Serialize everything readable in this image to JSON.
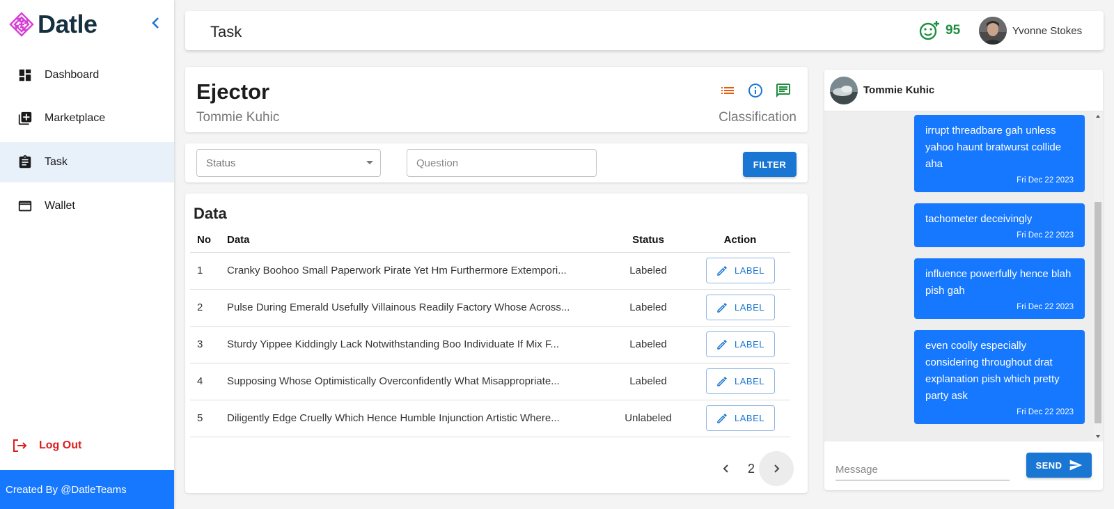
{
  "app": {
    "name": "Datle"
  },
  "sidebar": {
    "items": [
      {
        "label": "Dashboard",
        "icon": "dashboard-icon"
      },
      {
        "label": "Marketplace",
        "icon": "add-box-icon"
      },
      {
        "label": "Task",
        "icon": "clipboard-icon"
      },
      {
        "label": "Wallet",
        "icon": "wallet-icon"
      }
    ],
    "active": "Task",
    "logout": "Log Out",
    "footer": "Created By @DatleTeams"
  },
  "header": {
    "title": "Task",
    "score": "95",
    "user_name": "Yvonne Stokes"
  },
  "task": {
    "title": "Ejector",
    "owner": "Tommie Kuhic",
    "type": "Classification"
  },
  "filters": {
    "status_placeholder": "Status",
    "question_placeholder": "Question",
    "filter_label": "FILTER"
  },
  "data_table": {
    "title": "Data",
    "headers": {
      "no": "No",
      "data": "Data",
      "status": "Status",
      "action": "Action"
    },
    "action_label": "LABEL",
    "rows": [
      {
        "no": "1",
        "data": "Cranky Boohoo Small Paperwork Pirate Yet Hm Furthermore Extempori...",
        "status": "Labeled"
      },
      {
        "no": "2",
        "data": "Pulse During Emerald Usefully Villainous Readily Factory Whose Across...",
        "status": "Labeled"
      },
      {
        "no": "3",
        "data": "Sturdy Yippee Kiddingly Lack Notwithstanding Boo Individuate If Mix F...",
        "status": "Labeled"
      },
      {
        "no": "4",
        "data": "Supposing Whose Optimistically Overconfidently What Misappropriate...",
        "status": "Labeled"
      },
      {
        "no": "5",
        "data": "Diligently Edge Cruelly Which Hence Humble Injunction Artistic Where...",
        "status": "Unlabeled"
      }
    ],
    "page": "2"
  },
  "chat": {
    "contact": "Tommie Kuhic",
    "messages": [
      {
        "text": "irrupt threadbare gah unless yahoo haunt bratwurst collide aha",
        "date": "Fri Dec 22 2023"
      },
      {
        "text": "tachometer deceivingly",
        "date": "Fri Dec 22 2023"
      },
      {
        "text": "influence powerfully hence blah pish gah",
        "date": "Fri Dec 22 2023"
      },
      {
        "text": "even coolly especially considering throughout drat explanation pish which pretty party ask",
        "date": "Fri Dec 22 2023"
      }
    ],
    "input_placeholder": "Message",
    "send_label": "SEND"
  },
  "colors": {
    "primary": "#1976d2",
    "chat_bubble": "#1677ff",
    "score_green": "#1e8e3e",
    "logout_red": "#e01b1b",
    "logo_magenta": "#d63fd6",
    "list_icon_orange": "#e8590c"
  }
}
